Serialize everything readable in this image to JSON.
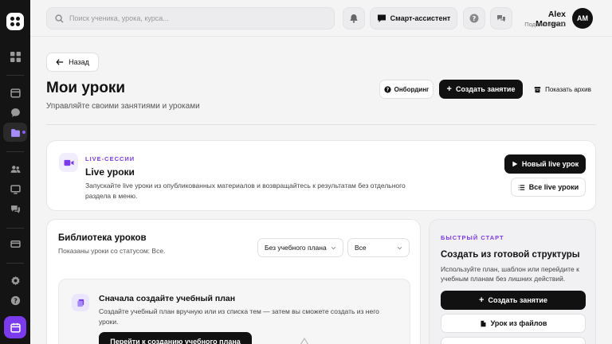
{
  "topbar": {
    "search_placeholder": "Поиск ученика, урока, курса...",
    "assistant_label": "Смарт-ассистент",
    "user_name": "Alex Morgan",
    "user_plan": "Подписка PRO",
    "avatar_initials": "AM"
  },
  "page": {
    "back_label": "Назад",
    "title": "Мои уроки",
    "subtitle": "Управляйте своими занятиями и уроками",
    "onboarding_label": "Онбординг",
    "create_label": "Создать занятие",
    "archive_label": "Показать архив"
  },
  "live": {
    "kicker": "LIVE-СЕССИИ",
    "title": "Live уроки",
    "description": "Запускайте live уроки из опубликованных материалов и возвращайтесь к результатам без отдельного раздела в меню.",
    "new_label": "Новый live урок",
    "all_label": "Все live уроки"
  },
  "library": {
    "title": "Библиотека уроков",
    "subtitle": "Показаны уроки со статусом: Все.",
    "plan_select": "Без учебного плана",
    "status_select": "Все",
    "empty_title": "Сначала создайте учебный план",
    "empty_desc": "Создайте учебный план вручную или из списка тем — затем вы сможете создать из него уроки.",
    "empty_button": "Перейти к созданию учебного плана"
  },
  "quick": {
    "kicker": "БЫСТРЫЙ СТАРТ",
    "title": "Создать из готовой структуры",
    "description": "Используйте план, шаблон или перейдите к учебным планам без лишних действий.",
    "create_label": "Создать занятие",
    "from_files_label": "Урок из файлов"
  },
  "colors": {
    "accent": "#7c3aed",
    "sidebar": "#141414",
    "primary_button": "#111111"
  }
}
